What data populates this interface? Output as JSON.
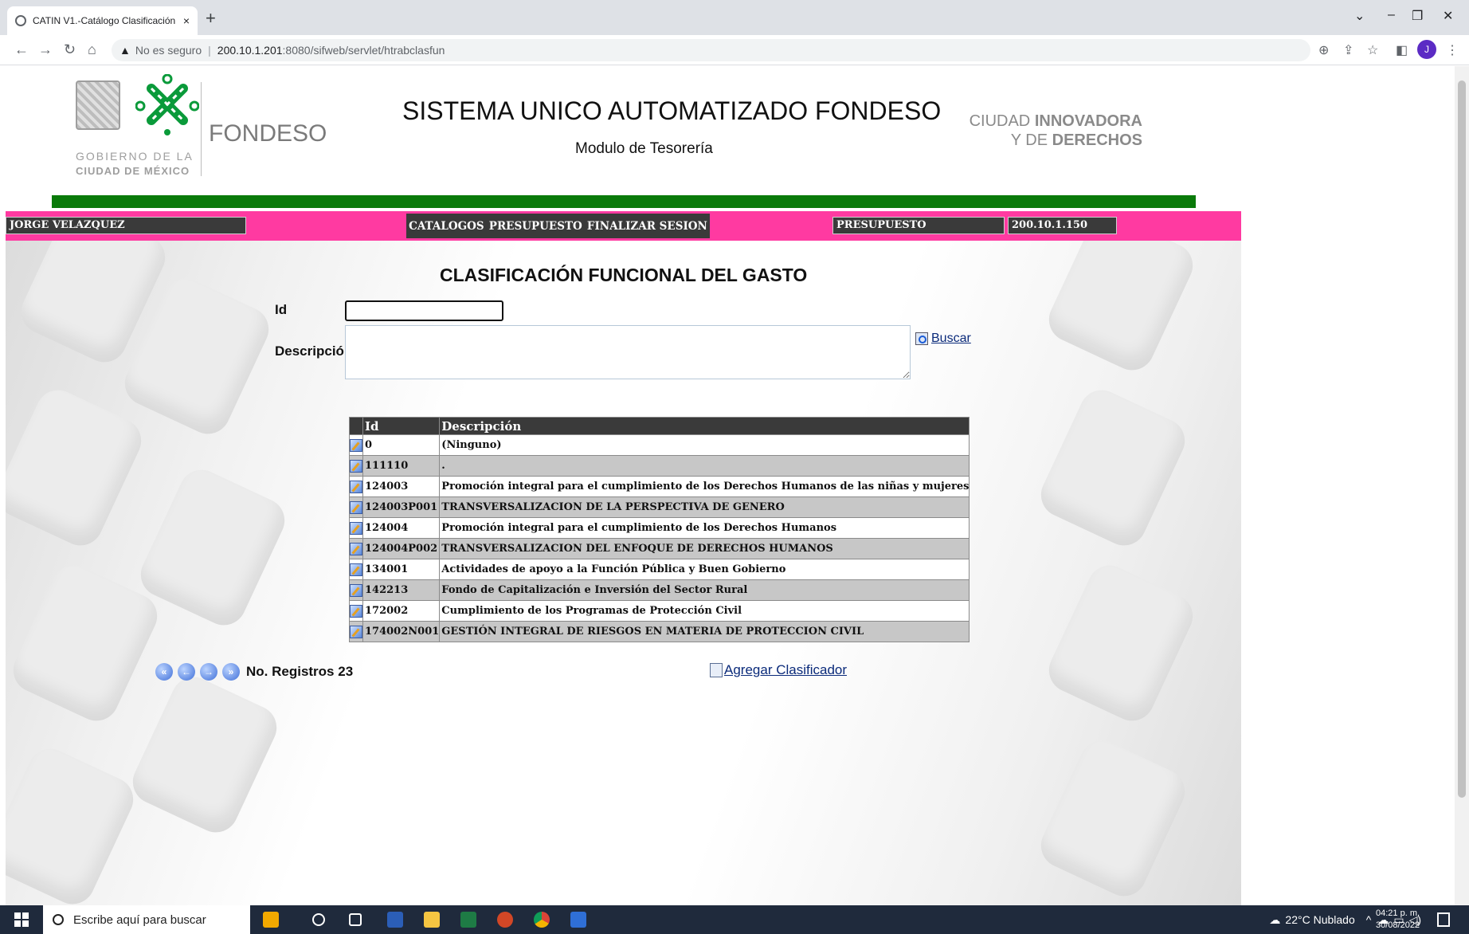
{
  "browser": {
    "tab_title": "CATIN V1.-Catálogo Clasificación",
    "new_tab": "+",
    "tab_close": "×",
    "security_label": "No es seguro",
    "url_host": "200.10.1.201",
    "url_path": ":8080/sifweb/servlet/htrabclasfun",
    "avatar_letter": "J"
  },
  "header": {
    "gobierno_line1": "GOBIERNO DE LA",
    "gobierno_line2": "CIUDAD DE MÉXICO",
    "fondeso": "FONDESO",
    "system_title": "SISTEMA UNICO AUTOMATIZADO FONDESO",
    "module": "Modulo de Tesorería",
    "ciudad_line1_a": "CIUDAD ",
    "ciudad_line1_b": "INNOVADORA",
    "ciudad_line2_a": "Y DE ",
    "ciudad_line2_b": "DERECHOS"
  },
  "navbar": {
    "user": "JORGE VELAZQUEZ",
    "menu": [
      "CATALOGOS",
      "PRESUPUESTO",
      "FINALIZAR SESION"
    ],
    "module_box": "PRESUPUESTO",
    "ip_box": "200.10.1.150"
  },
  "form": {
    "title": "CLASIFICACIÓN FUNCIONAL DEL GASTO",
    "id_label": "Id",
    "id_value": "",
    "desc_label": "Descripción",
    "desc_value": "",
    "search_label": "Buscar"
  },
  "table": {
    "columns": [
      "Id",
      "Descripción"
    ],
    "rows": [
      {
        "id": "0",
        "desc": "(Ninguno)"
      },
      {
        "id": "111110",
        "desc": "."
      },
      {
        "id": "124003",
        "desc": "Promoción integral para el cumplimiento de los Derechos Humanos de las niñas y mujeres"
      },
      {
        "id": "124003P001",
        "desc": "TRANSVERSALIZACION DE LA PERSPECTIVA DE GENERO"
      },
      {
        "id": "124004",
        "desc": "Promoción integral para el cumplimiento de los Derechos Humanos"
      },
      {
        "id": "124004P002",
        "desc": "TRANSVERSALIZACION DEL ENFOQUE DE DERECHOS HUMANOS"
      },
      {
        "id": "134001",
        "desc": "Actividades de apoyo a la Función Pública y Buen Gobierno"
      },
      {
        "id": "142213",
        "desc": "Fondo de Capitalización e Inversión del Sector Rural"
      },
      {
        "id": "172002",
        "desc": "Cumplimiento de los Programas de Protección Civil"
      },
      {
        "id": "174002N001",
        "desc": "GESTIÓN INTEGRAL DE RIESGOS EN MATERIA DE PROTECCION CIVIL"
      }
    ]
  },
  "pager": {
    "records_label": "No. Registros 23"
  },
  "add_label": "Agregar Clasificador",
  "taskbar": {
    "search_placeholder": "Escribe aquí para buscar",
    "weather": "22°C Nublado",
    "time": "04:21 p. m.",
    "date": "30/08/2022"
  }
}
